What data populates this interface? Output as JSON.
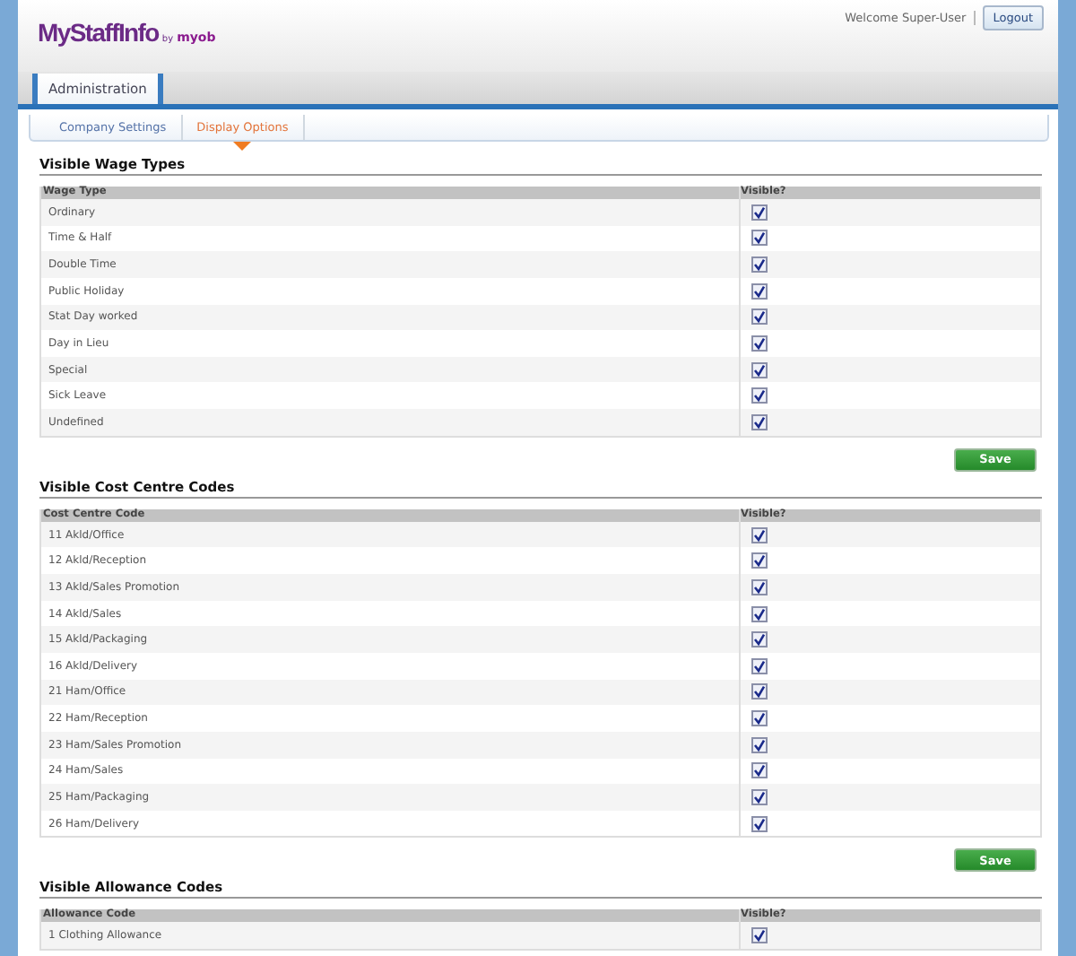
{
  "logo": {
    "name": "MyStaffInfo",
    "by": "by",
    "brand": "myob"
  },
  "user": {
    "welcome": "Welcome Super-User",
    "logout": "Logout"
  },
  "tabs": [
    {
      "label": "Administration",
      "selected": true
    }
  ],
  "subnav": [
    {
      "label": "Company Settings",
      "selected": false
    },
    {
      "label": "Display Options",
      "selected": true
    }
  ],
  "sections": [
    {
      "title": "Visible Wage Types",
      "columns": [
        "Wage Type",
        "Visible?"
      ],
      "rows": [
        {
          "name": "Ordinary",
          "checked": true
        },
        {
          "name": "Time & Half",
          "checked": true
        },
        {
          "name": "Double Time",
          "checked": true
        },
        {
          "name": "Public Holiday",
          "checked": true
        },
        {
          "name": "Stat Day worked",
          "checked": true
        },
        {
          "name": "Day in Lieu",
          "checked": true
        },
        {
          "name": "Special",
          "checked": true
        },
        {
          "name": "Sick Leave",
          "checked": true
        },
        {
          "name": "Undefined",
          "checked": true
        }
      ],
      "save": "Save"
    },
    {
      "title": "Visible Cost Centre Codes",
      "columns": [
        "Cost Centre Code",
        "Visible?"
      ],
      "rows": [
        {
          "name": "11 Akld/Office",
          "checked": true
        },
        {
          "name": "12 Akld/Reception",
          "checked": true
        },
        {
          "name": "13 Akld/Sales Promotion",
          "checked": true
        },
        {
          "name": "14 Akld/Sales",
          "checked": true
        },
        {
          "name": "15 Akld/Packaging",
          "checked": true
        },
        {
          "name": "16 Akld/Delivery",
          "checked": true
        },
        {
          "name": "21 Ham/Office",
          "checked": true
        },
        {
          "name": "22 Ham/Reception",
          "checked": true
        },
        {
          "name": "23 Ham/Sales Promotion",
          "checked": true
        },
        {
          "name": "24 Ham/Sales",
          "checked": true
        },
        {
          "name": "25 Ham/Packaging",
          "checked": true
        },
        {
          "name": "26 Ham/Delivery",
          "checked": true
        }
      ],
      "save": "Save"
    },
    {
      "title": "Visible Allowance Codes",
      "columns": [
        "Allowance Code",
        "Visible?"
      ],
      "rows": [
        {
          "name": "1 Clothing Allowance",
          "checked": true
        }
      ]
    }
  ]
}
